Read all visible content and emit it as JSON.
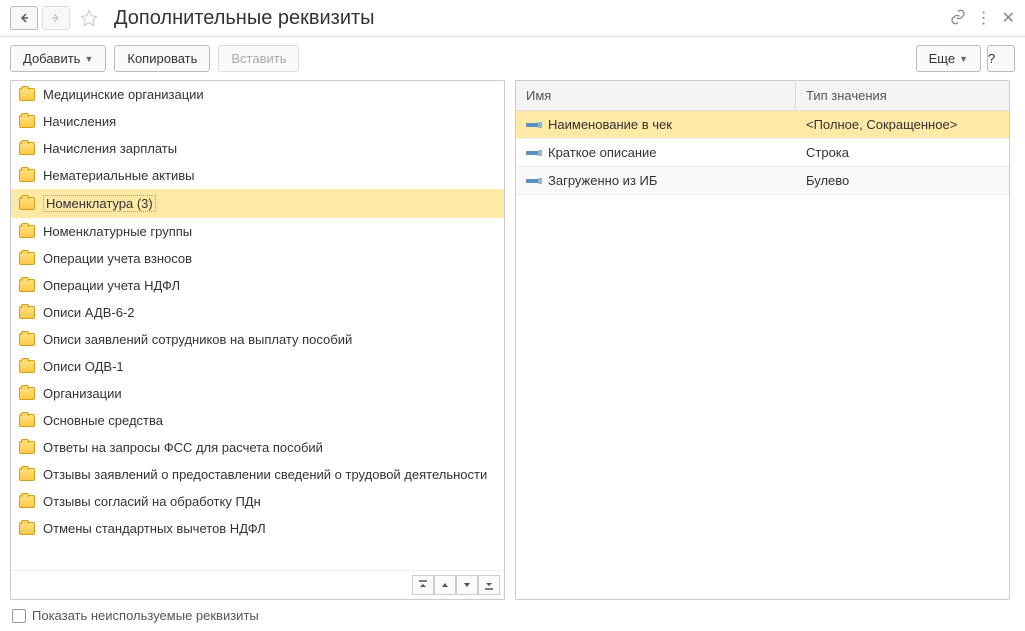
{
  "header": {
    "title": "Дополнительные реквизиты"
  },
  "toolbar": {
    "add_label": "Добавить",
    "copy_label": "Копировать",
    "paste_label": "Вставить",
    "more_label": "Еще",
    "help_label": "?"
  },
  "tree": {
    "items": [
      {
        "label": "Медицинские организации",
        "selected": false
      },
      {
        "label": "Начисления",
        "selected": false
      },
      {
        "label": "Начисления зарплаты",
        "selected": false
      },
      {
        "label": "Нематериальные активы",
        "selected": false
      },
      {
        "label": "Номенклатура (3)",
        "selected": true
      },
      {
        "label": "Номенклатурные группы",
        "selected": false
      },
      {
        "label": "Операции учета взносов",
        "selected": false
      },
      {
        "label": "Операции учета НДФЛ",
        "selected": false
      },
      {
        "label": "Описи АДВ-6-2",
        "selected": false
      },
      {
        "label": "Описи заявлений сотрудников на выплату пособий",
        "selected": false
      },
      {
        "label": "Описи ОДВ-1",
        "selected": false
      },
      {
        "label": "Организации",
        "selected": false
      },
      {
        "label": "Основные средства",
        "selected": false
      },
      {
        "label": "Ответы на запросы ФСС для расчета пособий",
        "selected": false
      },
      {
        "label": "Отзывы заявлений о предоставлении сведений о трудовой деятельности",
        "selected": false
      },
      {
        "label": "Отзывы согласий на обработку ПДн",
        "selected": false
      },
      {
        "label": "Отмены стандартных вычетов НДФЛ",
        "selected": false
      }
    ]
  },
  "table": {
    "header_name": "Имя",
    "header_type": "Тип значения",
    "rows": [
      {
        "name": "Наименование в чек",
        "type": "<Полное, Сокращенное>",
        "selected": true,
        "alt": false
      },
      {
        "name": "Краткое описание",
        "type": "Строка",
        "selected": false,
        "alt": false
      },
      {
        "name": "Загруженно из ИБ",
        "type": "Булево",
        "selected": false,
        "alt": true
      }
    ]
  },
  "footer": {
    "show_unused_label": "Показать неиспользуемые реквизиты"
  }
}
